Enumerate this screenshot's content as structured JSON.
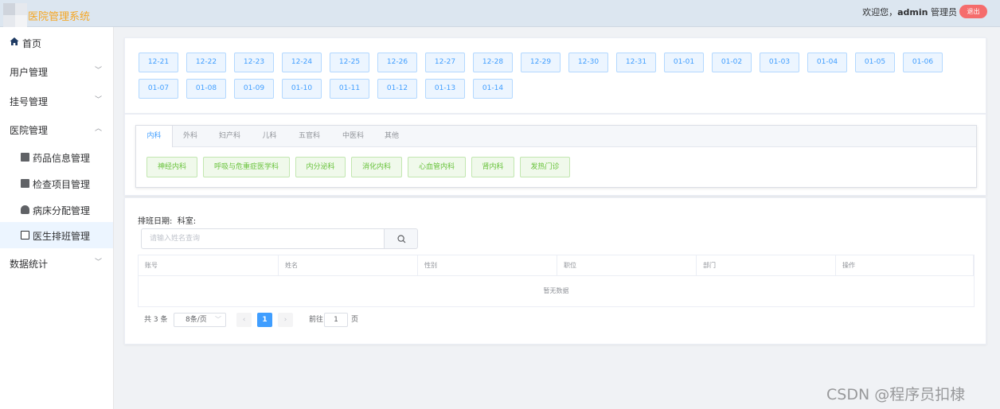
{
  "header": {
    "title": "医院管理系统",
    "welcome_prefix": "欢迎您，",
    "username": "admin",
    "role": "管理员",
    "logout_label": "退出"
  },
  "sidebar": {
    "items": [
      {
        "label": "首页"
      },
      {
        "label": "用户管理"
      },
      {
        "label": "挂号管理"
      },
      {
        "label": "医院管理"
      },
      {
        "label": "药品信息管理"
      },
      {
        "label": "检查项目管理"
      },
      {
        "label": "病床分配管理"
      },
      {
        "label": "医生排班管理"
      },
      {
        "label": "数据统计"
      }
    ]
  },
  "dates": [
    "12-21",
    "12-22",
    "12-23",
    "12-24",
    "12-25",
    "12-26",
    "12-27",
    "12-28",
    "12-29",
    "12-30",
    "12-31",
    "01-01",
    "01-02",
    "01-03",
    "01-04",
    "01-05",
    "01-06",
    "01-07",
    "01-08",
    "01-09",
    "01-10",
    "01-11",
    "01-12",
    "01-13",
    "01-14"
  ],
  "tabs": [
    "内科",
    "外科",
    "妇产科",
    "儿科",
    "五官科",
    "中医科",
    "其他"
  ],
  "departments": [
    "神经内科",
    "呼吸与危重症医学科",
    "内分泌科",
    "消化内科",
    "心血管内科",
    "肾内科",
    "发热门诊"
  ],
  "schedule": {
    "date_label": "排班日期:",
    "dept_label": "科室:",
    "search_placeholder": "请输入姓名查询",
    "columns": [
      "账号",
      "姓名",
      "性别",
      "职位",
      "部门",
      "操作"
    ],
    "empty_text": "暂无数据"
  },
  "pagination": {
    "total": "共 3 条",
    "page_size": "8条/页",
    "current_page": "1",
    "goto_prefix": "前往",
    "goto_value": "1",
    "goto_suffix": "页"
  },
  "watermark": "CSDN @程序员扣棣",
  "colors": {
    "accent": "#409eff",
    "success": "#67c23a",
    "danger": "#f56c6c",
    "title": "#f5a623"
  }
}
